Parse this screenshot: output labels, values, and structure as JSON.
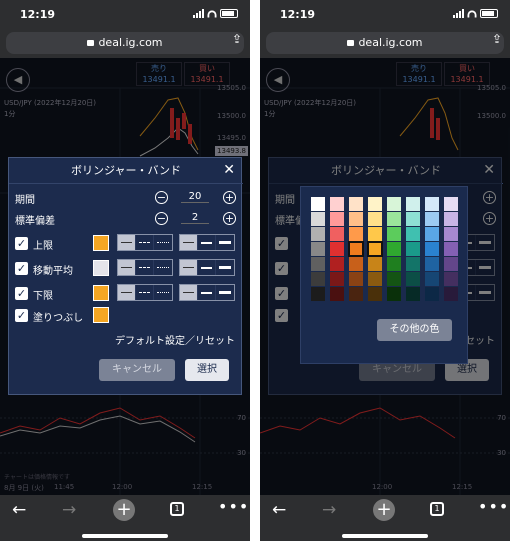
{
  "status": {
    "time": "12:19"
  },
  "browser": {
    "url": "deal.ig.com",
    "tab_count": "1"
  },
  "chart": {
    "symbol": "USD/JPY (2022年12月20日)",
    "timeframe": "1分",
    "bid_label": "売り",
    "bid": "13491.1",
    "ask_label": "買い",
    "ask": "13491.1",
    "price_levels": [
      "13505.0",
      "13500.0",
      "13495.0"
    ],
    "current_price": "13493.8",
    "oscillator_levels": [
      "70",
      "30"
    ],
    "times": [
      "12:00",
      "12:15"
    ],
    "date_label": "8月 9日 (火)",
    "time_left": "11:45",
    "note": "チャートは価格情報です"
  },
  "dialog": {
    "title": "ボリンジャー・バンド",
    "period_label": "期間",
    "period_value": "20",
    "stddev_label": "標準偏差",
    "stddev_value": "2",
    "lines": [
      {
        "label": "上限",
        "color": "#f5a623",
        "checked": true
      },
      {
        "label": "移動平均",
        "color": "#e4e4ea",
        "checked": true
      },
      {
        "label": "下限",
        "color": "#f5a623",
        "checked": true
      },
      {
        "label": "塗りつぶし",
        "color": "#f5a623",
        "checked": true
      }
    ],
    "reset_label": "デフォルト設定／リセット",
    "cancel_label": "キャンセル",
    "select_label": "選択"
  },
  "palette": {
    "other_colors_label": "その他の色",
    "selected": "#f07c1e"
  }
}
